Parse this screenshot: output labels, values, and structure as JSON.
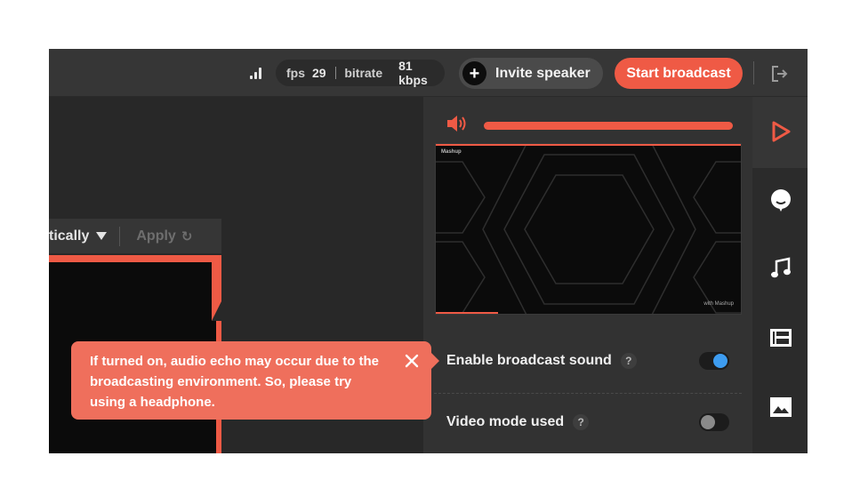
{
  "topbar": {
    "stats": {
      "fps_label": "fps",
      "fps_value": "29",
      "bitrate_label": "bitrate",
      "bitrate_value": "81 kbps"
    },
    "invite_label": "Invite speaker",
    "start_label": "Start broadcast",
    "icons": [
      "signal-icon",
      "plus-icon",
      "exit-icon"
    ]
  },
  "workspace": {
    "mode_label": "tically",
    "apply_label": "Apply",
    "icons": [
      "chevron-down-icon",
      "refresh-icon"
    ]
  },
  "tooltip": {
    "text": "If turned on, audio echo may occur due to the broadcasting environment. So, please try using a headphone.",
    "icon": "close-icon"
  },
  "preview": {
    "volume_level": 1.0,
    "screen_logo": "Mashup",
    "screen_watermark": "with Mashup",
    "settings": [
      {
        "label": "Enable broadcast sound",
        "help": "?",
        "enabled": true
      },
      {
        "label": "Video mode used",
        "help": "?",
        "enabled": false
      }
    ]
  },
  "sidebar": {
    "items": [
      "play-icon",
      "chat-icon",
      "music-icon",
      "layout-icon",
      "image-icon"
    ],
    "active": "play-icon"
  },
  "colors": {
    "accent": "#ef5a45",
    "tooltip": "#ef6f5c",
    "toggle_on": "#3d9cf0",
    "background": "#262626"
  }
}
